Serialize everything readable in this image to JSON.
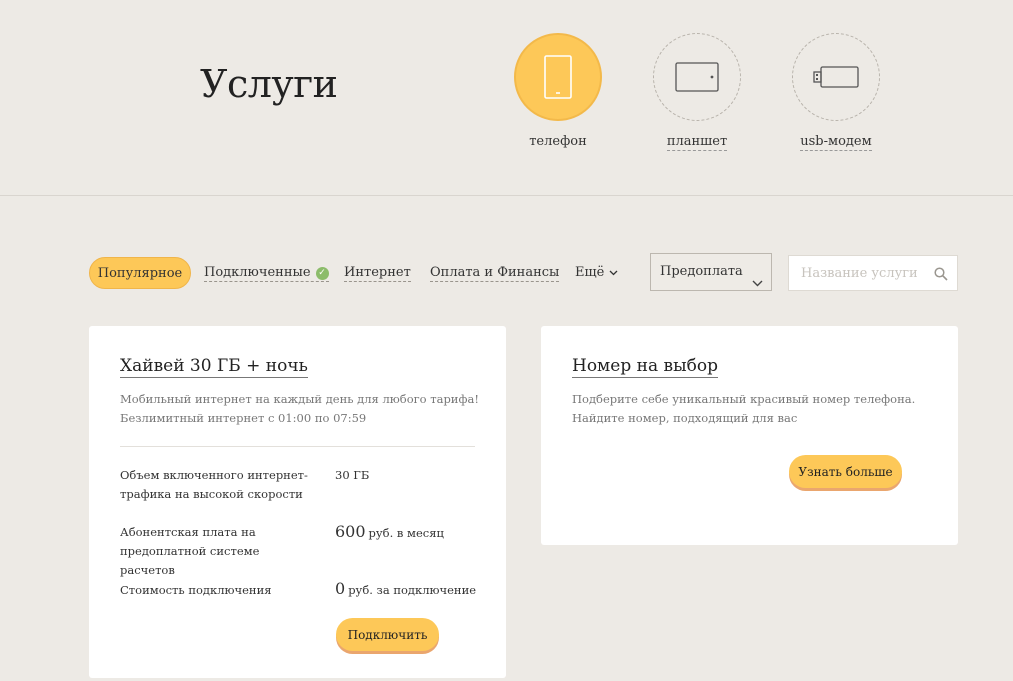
{
  "header": {
    "title": "Услуги",
    "devices": [
      {
        "label": "телефон",
        "icon": "phone-icon",
        "active": true
      },
      {
        "label": "планшет",
        "icon": "tablet-icon",
        "active": false
      },
      {
        "label": "usb-модем",
        "icon": "usb-modem-icon",
        "active": false
      }
    ]
  },
  "filters": {
    "tabs": [
      {
        "label": "Популярное",
        "active": true
      },
      {
        "label": "Подключенные",
        "badge_icon": "check-icon"
      },
      {
        "label": "Интернет"
      },
      {
        "label": "Оплата и Финансы"
      }
    ],
    "more_label": "Ещё",
    "payment_select": {
      "value": "Предоплата"
    },
    "search": {
      "placeholder": "Название услуги"
    }
  },
  "cards": [
    {
      "title": "Хайвей 30 ГБ + ночь",
      "description_lines": [
        "Мобильный интернет на каждый день для любого тарифа!",
        "Безлимитный интернет с 01:00 по 07:59"
      ],
      "params": [
        {
          "label_lines": [
            "Объем включенного интернет-",
            "трафика на высокой скорости"
          ],
          "value": "30 ГБ",
          "big": "",
          "unit": ""
        },
        {
          "label_lines": [
            "Абонентская плата на",
            "предоплатной системе расчетов"
          ],
          "value": "",
          "big": "600",
          "unit": "руб. в месяц"
        },
        {
          "label_lines": [
            "Стоимость подключения"
          ],
          "value": "",
          "big": "0",
          "unit": "руб. за подключение"
        }
      ],
      "button_label": "Подключить"
    },
    {
      "title": "Номер на выбор",
      "description_lines": [
        "Подберите себе уникальный красивый номер телефона.",
        "Найдите номер, подходящий для вас"
      ],
      "button_label": "Узнать больше"
    }
  ],
  "colors": {
    "accent": "#fdc858",
    "background": "#edeae5",
    "check": "#8cbc6a"
  }
}
